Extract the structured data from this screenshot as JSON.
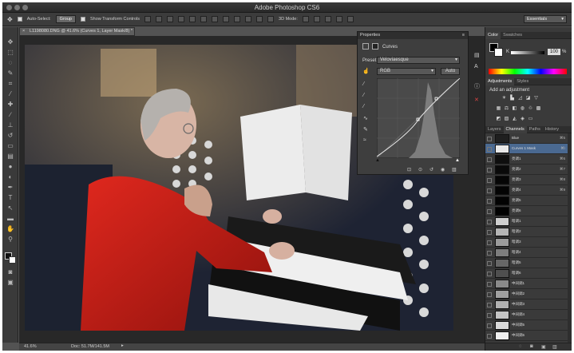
{
  "app": {
    "title": "Adobe Photoshop CS6"
  },
  "options_bar": {
    "auto_select_label": "Auto-Select:",
    "auto_select_value": "Group",
    "transform_label": "Show Transform Controls",
    "mode_3d": "3D Mode:",
    "workspace": "Essentials"
  },
  "document": {
    "tab_title": "L1198080.DNG @ 41.6% (Curves 1, Layer Mask/8) *",
    "zoom": "41.6%",
    "doc_size": "Doc: 51.7M/141.5M"
  },
  "properties": {
    "tab": "Properties",
    "adj_name": "Curves",
    "preset_label": "Preset:",
    "preset_value": "Veloviaesque",
    "channel_value": "RGB",
    "auto_label": "Auto"
  },
  "color_panel": {
    "tabs": [
      "Color",
      "Swatches"
    ],
    "k_label": "K",
    "k_value": "100",
    "k_unit": "%"
  },
  "adjustments_panel": {
    "tabs": [
      "Adjustments",
      "Styles"
    ],
    "subtitle": "Add an adjustment"
  },
  "channels_panel": {
    "tabs": [
      "Layers",
      "Channels",
      "Paths",
      "History"
    ],
    "rows": [
      {
        "name": "Blue",
        "shortcut": "⌘5",
        "shade": "#1f1f1f"
      },
      {
        "name": "Curves 1 Mask",
        "shortcut": "⌘\\",
        "shade": "#e8e8e8"
      },
      {
        "name": "亮调1",
        "shortcut": "⌘6",
        "shade": "#0f0f0f"
      },
      {
        "name": "亮调2",
        "shortcut": "⌘7",
        "shade": "#0a0a0a"
      },
      {
        "name": "亮调3",
        "shortcut": "⌘8",
        "shade": "#060606"
      },
      {
        "name": "亮调4",
        "shortcut": "⌘9",
        "shade": "#040404"
      },
      {
        "name": "亮调5",
        "shortcut": "",
        "shade": "#030303"
      },
      {
        "name": "亮调6",
        "shortcut": "",
        "shade": "#020202"
      },
      {
        "name": "暗调1",
        "shortcut": "",
        "shade": "#cfcfcf"
      },
      {
        "name": "暗调2",
        "shortcut": "",
        "shade": "#b5b5b5"
      },
      {
        "name": "暗调3",
        "shortcut": "",
        "shade": "#9a9a9a"
      },
      {
        "name": "暗调4",
        "shortcut": "",
        "shade": "#7d7d7d"
      },
      {
        "name": "暗调5",
        "shortcut": "",
        "shade": "#666666"
      },
      {
        "name": "暗调6",
        "shortcut": "",
        "shade": "#4f4f4f"
      },
      {
        "name": "中间调1",
        "shortcut": "",
        "shade": "#8a8a8a"
      },
      {
        "name": "中间调2",
        "shortcut": "",
        "shade": "#9f9f9f"
      },
      {
        "name": "中间调3",
        "shortcut": "",
        "shade": "#b0b0b0"
      },
      {
        "name": "中间调4",
        "shortcut": "",
        "shade": "#c4c4c4"
      },
      {
        "name": "中间调5",
        "shortcut": "",
        "shade": "#dadada"
      },
      {
        "name": "中间调6",
        "shortcut": "",
        "shade": "#efefef"
      }
    ]
  },
  "colors": {
    "selected_row": "#4a6991",
    "panel_bg": "#3a3a3a"
  }
}
